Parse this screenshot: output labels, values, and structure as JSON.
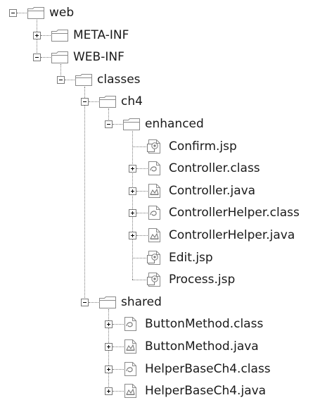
{
  "tree": {
    "nodes": [
      {
        "id": "web",
        "label": "web",
        "depth": 0,
        "kind": "folder",
        "toggle": "minus",
        "last": true
      },
      {
        "id": "meta-inf",
        "label": "META-INF",
        "depth": 1,
        "kind": "folder",
        "toggle": "plus",
        "last": false
      },
      {
        "id": "web-inf",
        "label": "WEB-INF",
        "depth": 1,
        "kind": "folder",
        "toggle": "minus",
        "last": true
      },
      {
        "id": "classes",
        "label": "classes",
        "depth": 2,
        "kind": "folder",
        "toggle": "minus",
        "last": true
      },
      {
        "id": "ch4",
        "label": "ch4",
        "depth": 3,
        "kind": "folder",
        "toggle": "minus",
        "last": false
      },
      {
        "id": "enhanced",
        "label": "enhanced",
        "depth": 4,
        "kind": "folder",
        "toggle": "minus",
        "last": true
      },
      {
        "id": "confirm-jsp",
        "label": "Confirm.jsp",
        "depth": 5,
        "kind": "jsp",
        "toggle": "none",
        "last": false
      },
      {
        "id": "controller-class",
        "label": "Controller.class",
        "depth": 5,
        "kind": "class",
        "toggle": "plus",
        "last": false
      },
      {
        "id": "controller-java",
        "label": "Controller.java",
        "depth": 5,
        "kind": "java",
        "toggle": "plus",
        "last": false
      },
      {
        "id": "controllerhelper-class",
        "label": "ControllerHelper.class",
        "depth": 5,
        "kind": "class",
        "toggle": "plus",
        "last": false
      },
      {
        "id": "controllerhelper-java",
        "label": "ControllerHelper.java",
        "depth": 5,
        "kind": "java",
        "toggle": "plus",
        "last": false
      },
      {
        "id": "edit-jsp",
        "label": "Edit.jsp",
        "depth": 5,
        "kind": "jsp",
        "toggle": "none",
        "last": false
      },
      {
        "id": "process-jsp",
        "label": "Process.jsp",
        "depth": 5,
        "kind": "jsp",
        "toggle": "none",
        "last": true
      },
      {
        "id": "shared",
        "label": "shared",
        "depth": 3,
        "kind": "folder",
        "toggle": "minus",
        "last": true
      },
      {
        "id": "buttonmethod-class",
        "label": "ButtonMethod.class",
        "depth": 4,
        "kind": "class",
        "toggle": "plus",
        "last": false
      },
      {
        "id": "buttonmethod-java",
        "label": "ButtonMethod.java",
        "depth": 4,
        "kind": "java",
        "toggle": "plus",
        "last": false
      },
      {
        "id": "helperbasech4-class",
        "label": "HelperBaseCh4.class",
        "depth": 4,
        "kind": "class",
        "toggle": "plus",
        "last": false
      },
      {
        "id": "helperbasech4-java",
        "label": "HelperBaseCh4.java",
        "depth": 4,
        "kind": "java",
        "toggle": "plus",
        "last": true
      }
    ]
  },
  "colors": {
    "line": "#7a7a7a",
    "folder_fill": "#ffffff",
    "folder_stroke": "#8a8a8a",
    "file_stroke": "#8a8a8a",
    "text": "#1a1a1a"
  }
}
